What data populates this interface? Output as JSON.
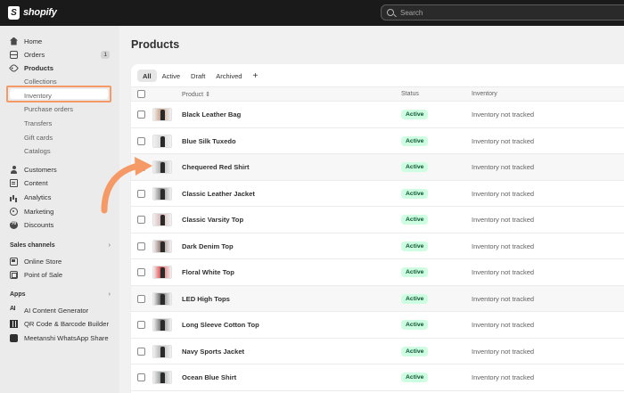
{
  "app": {
    "logo_text": "shopify"
  },
  "search": {
    "placeholder": "Search"
  },
  "sidebar": {
    "main_items": [
      {
        "label": "Home",
        "icon": "home-icon"
      },
      {
        "label": "Orders",
        "icon": "orders-icon",
        "badge": "1"
      },
      {
        "label": "Products",
        "icon": "tag-icon"
      }
    ],
    "product_subitems": [
      "Collections",
      "Inventory",
      "Purchase orders",
      "Transfers",
      "Gift cards",
      "Catalogs"
    ],
    "more_items": [
      {
        "label": "Customers",
        "icon": "person-icon"
      },
      {
        "label": "Content",
        "icon": "content-icon"
      },
      {
        "label": "Analytics",
        "icon": "analytics-icon"
      },
      {
        "label": "Marketing",
        "icon": "marketing-icon"
      },
      {
        "label": "Discounts",
        "icon": "discount-icon"
      }
    ],
    "sales_channels_label": "Sales channels",
    "sales_channels": [
      {
        "label": "Online Store",
        "icon": "store-icon"
      },
      {
        "label": "Point of Sale",
        "icon": "pos-icon"
      }
    ],
    "apps_label": "Apps",
    "apps": [
      {
        "label": "AI Content Generator",
        "icon": "ai-icon"
      },
      {
        "label": "QR Code & Barcode Builder",
        "icon": "qr-icon"
      },
      {
        "label": "Meetanshi WhatsApp Share",
        "icon": "whatsapp-icon"
      }
    ]
  },
  "main": {
    "title": "Products",
    "tabs": [
      "All",
      "Active",
      "Draft",
      "Archived",
      "+"
    ],
    "columns": {
      "product": "Product",
      "sort_glyph": "⇕",
      "status": "Status",
      "inventory": "Inventory"
    },
    "products": [
      {
        "name": "Black Leather Bag",
        "status": "Active",
        "inventory": "Inventory not tracked",
        "thumb": "#c9a48a"
      },
      {
        "name": "Blue Silk Tuxedo",
        "status": "Active",
        "inventory": "Inventory not tracked",
        "thumb": "#d9d9d9"
      },
      {
        "name": "Chequered Red Shirt",
        "status": "Active",
        "inventory": "Inventory not tracked",
        "thumb": "#b0b0b0"
      },
      {
        "name": "Classic Leather Jacket",
        "status": "Active",
        "inventory": "Inventory not tracked",
        "thumb": "#8a8a8a"
      },
      {
        "name": "Classic Varsity Top",
        "status": "Active",
        "inventory": "Inventory not tracked",
        "thumb": "#d8b8b8"
      },
      {
        "name": "Dark Denim Top",
        "status": "Active",
        "inventory": "Inventory not tracked",
        "thumb": "#9a7f7a"
      },
      {
        "name": "Floral White Top",
        "status": "Active",
        "inventory": "Inventory not tracked",
        "thumb": "#e05555"
      },
      {
        "name": "LED High Tops",
        "status": "Active",
        "inventory": "Inventory not tracked",
        "thumb": "#6a6a6a"
      },
      {
        "name": "Long Sleeve Cotton Top",
        "status": "Active",
        "inventory": "Inventory not tracked",
        "thumb": "#7a7a7a"
      },
      {
        "name": "Navy Sports Jacket",
        "status": "Active",
        "inventory": "Inventory not tracked",
        "thumb": "#b5b5b5"
      },
      {
        "name": "Ocean Blue Shirt",
        "status": "Active",
        "inventory": "Inventory not tracked",
        "thumb": "#9aa0a0"
      }
    ]
  },
  "colors": {
    "accent_highlight": "#f59a66",
    "active_badge_bg": "#cdfee1",
    "active_badge_text": "#0c5132",
    "topbar": "#1a1a1a"
  }
}
